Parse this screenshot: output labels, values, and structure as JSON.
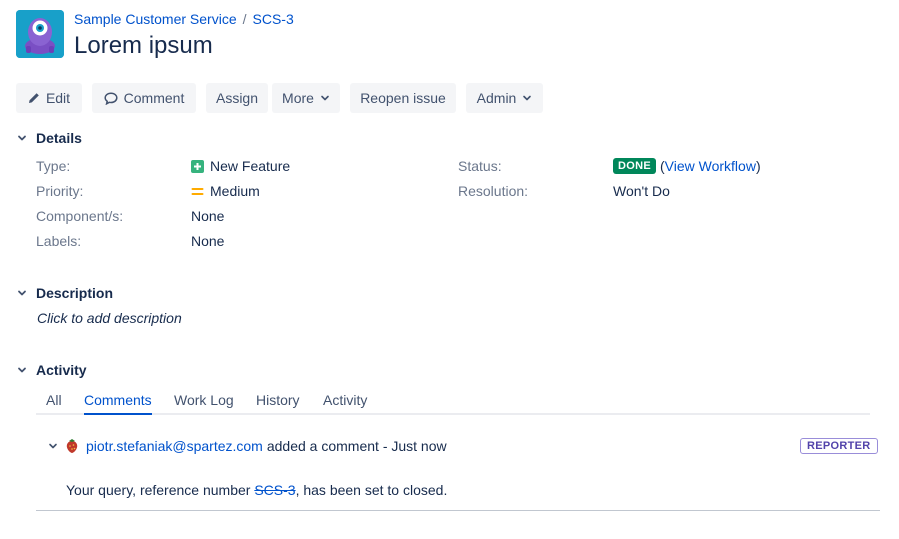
{
  "breadcrumbs": {
    "project": "Sample Customer Service",
    "separator": "/",
    "issue_key": "SCS-3"
  },
  "issue": {
    "title": "Lorem ipsum"
  },
  "toolbar": {
    "edit": "Edit",
    "comment": "Comment",
    "assign": "Assign",
    "more": "More",
    "reopen": "Reopen issue",
    "admin": "Admin"
  },
  "details": {
    "heading": "Details",
    "type_label": "Type:",
    "type_value": "New Feature",
    "priority_label": "Priority:",
    "priority_value": "Medium",
    "components_label": "Component/s:",
    "components_value": "None",
    "labels_label": "Labels:",
    "labels_value": "None",
    "status_label": "Status:",
    "status_value": "DONE",
    "view_workflow": "View Workflow",
    "resolution_label": "Resolution:",
    "resolution_value": "Won't Do"
  },
  "description": {
    "heading": "Description",
    "placeholder": "Click to add description"
  },
  "activity": {
    "heading": "Activity",
    "tabs": [
      "All",
      "Comments",
      "Work Log",
      "History",
      "Activity"
    ],
    "active_tab": "Comments"
  },
  "comment": {
    "author": "piotr.stefaniak@spartez.com",
    "action": "added a comment - Just now",
    "badge": "REPORTER",
    "body_prefix": "Your query, reference number ",
    "body_ref": "SCS-3",
    "body_suffix": ", has been set to closed."
  },
  "colors": {
    "link": "#0052cc",
    "done": "#00875a",
    "new_feature": "#36b37e",
    "priority_medium": "#ffab00",
    "avatar_bg": "#18a0c9"
  }
}
